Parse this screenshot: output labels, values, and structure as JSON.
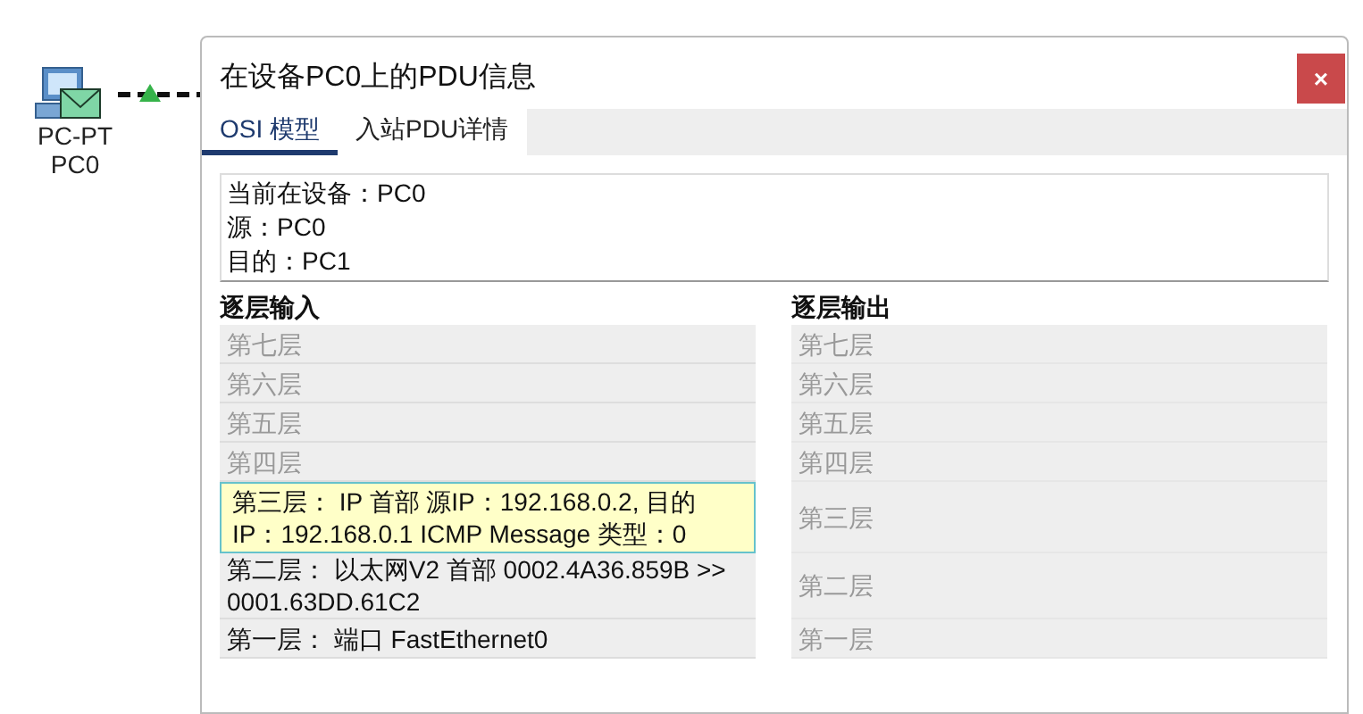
{
  "canvas": {
    "device": {
      "type": "PC-PT",
      "name": "PC0"
    }
  },
  "dialog": {
    "title": "在设备PC0上的PDU信息",
    "close": "×",
    "tabs": [
      {
        "label": "OSI 模型",
        "selected": true
      },
      {
        "label": "入站PDU详情",
        "selected": false
      }
    ],
    "info": [
      "当前在设备：PC0",
      "源：PC0",
      "目的：PC1"
    ],
    "input": {
      "header": "逐层输入",
      "rows": [
        {
          "text": "第七层",
          "active": false,
          "selected": false
        },
        {
          "text": "第六层",
          "active": false,
          "selected": false
        },
        {
          "text": "第五层",
          "active": false,
          "selected": false
        },
        {
          "text": "第四层",
          "active": false,
          "selected": false
        },
        {
          "text": "第三层： IP 首部 源IP：192.168.0.2, 目的IP：192.168.0.1 ICMP Message 类型：0",
          "active": true,
          "selected": true
        },
        {
          "text": "第二层： 以太网V2 首部 0002.4A36.859B >> 0001.63DD.61C2",
          "active": true,
          "selected": false
        },
        {
          "text": "第一层： 端口 FastEthernet0",
          "active": true,
          "selected": false
        }
      ]
    },
    "output": {
      "header": "逐层输出",
      "rows": [
        {
          "text": "第七层",
          "active": false
        },
        {
          "text": "第六层",
          "active": false
        },
        {
          "text": "第五层",
          "active": false
        },
        {
          "text": "第四层",
          "active": false
        },
        {
          "text": "第三层",
          "active": false
        },
        {
          "text": "第二层",
          "active": false
        },
        {
          "text": "第一层",
          "active": false
        }
      ]
    }
  }
}
